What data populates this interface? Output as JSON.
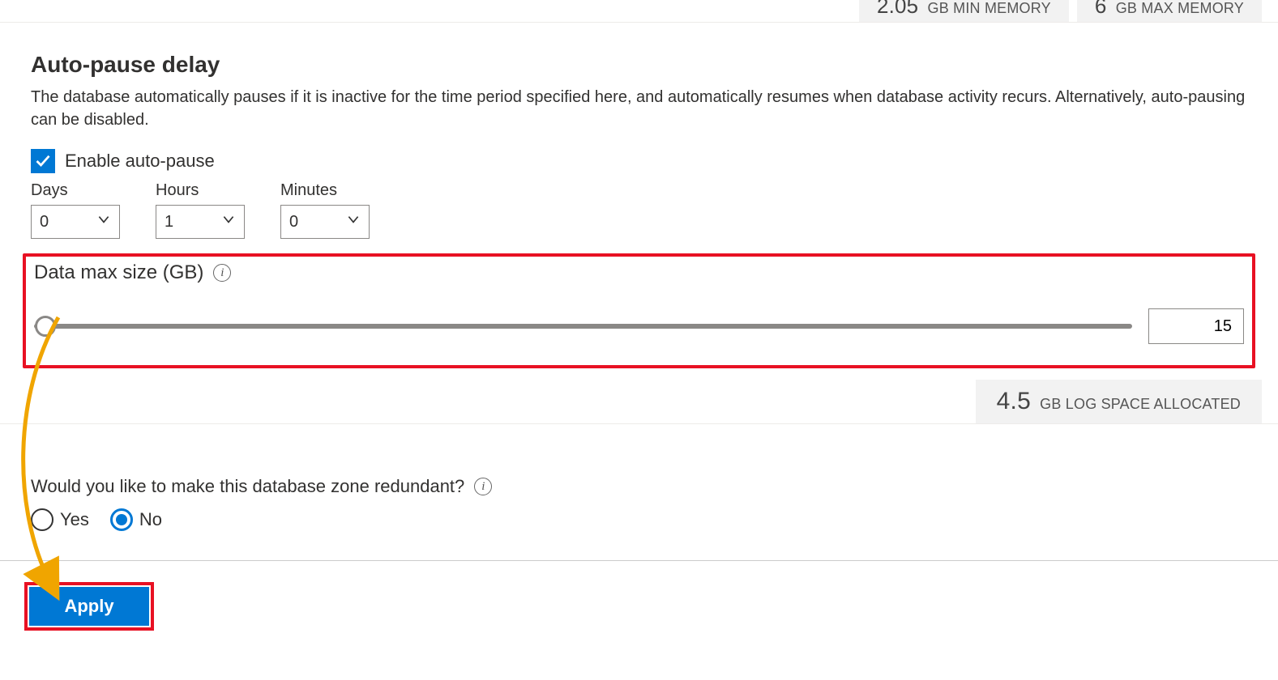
{
  "memory_bar": {
    "min_value": "2.05",
    "min_label": "GB MIN MEMORY",
    "max_value": "6",
    "max_label": "GB MAX MEMORY"
  },
  "autopause": {
    "title": "Auto-pause delay",
    "description": "The database automatically pauses if it is inactive for the time period specified here, and automatically resumes when database activity recurs. Alternatively, auto-pausing can be disabled.",
    "checkbox_label": "Enable auto-pause",
    "days_label": "Days",
    "days_value": "0",
    "hours_label": "Hours",
    "hours_value": "1",
    "minutes_label": "Minutes",
    "minutes_value": "0"
  },
  "data_size": {
    "title": "Data max size (GB)",
    "value": "15"
  },
  "log_space": {
    "value": "4.5",
    "label": "GB LOG SPACE ALLOCATED"
  },
  "zone": {
    "question": "Would you like to make this database zone redundant?",
    "yes_label": "Yes",
    "no_label": "No"
  },
  "footer": {
    "apply_label": "Apply"
  }
}
